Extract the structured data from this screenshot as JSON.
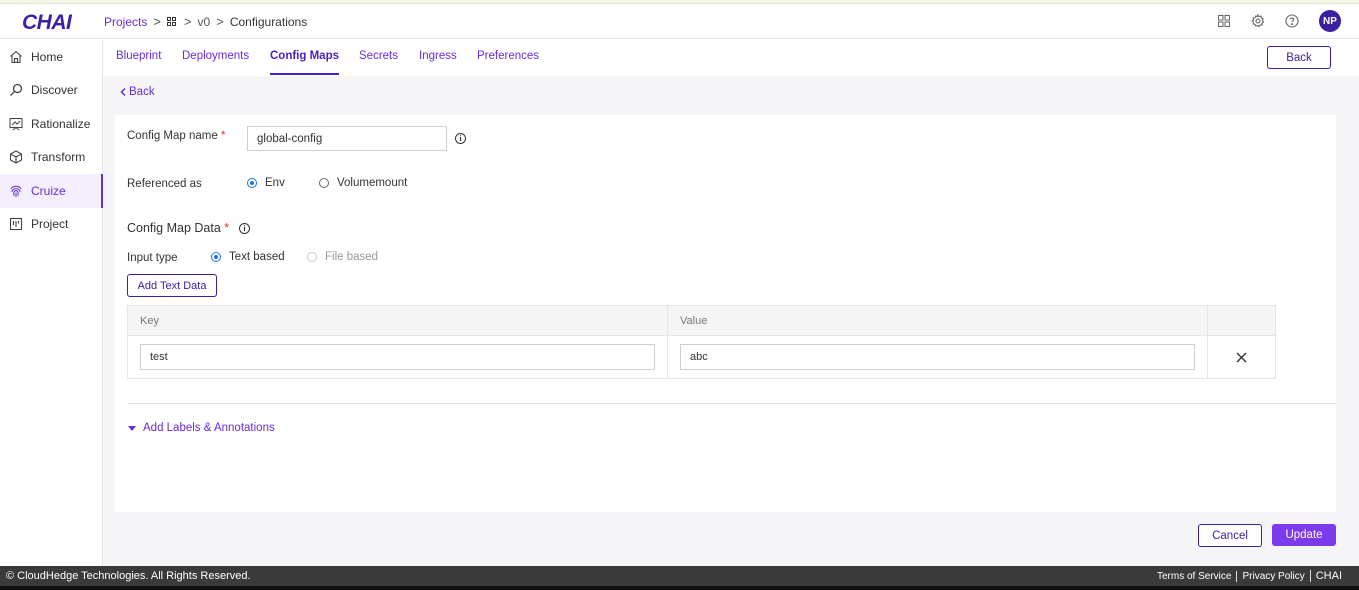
{
  "app": {
    "logo_text": "CHAI"
  },
  "breadcrumb": {
    "projects": "Projects",
    "sep1": ">",
    "sep2": ">",
    "version": "v0",
    "sep3": ">",
    "current": "Configurations"
  },
  "header": {
    "avatar_initials": "NP",
    "icons": [
      "apps-grid-icon",
      "gear-icon",
      "help-icon"
    ]
  },
  "sidebar": {
    "items": [
      {
        "label": "Home",
        "icon": "home-icon"
      },
      {
        "label": "Discover",
        "icon": "discover-icon"
      },
      {
        "label": "Rationalize",
        "icon": "rationalize-icon"
      },
      {
        "label": "Transform",
        "icon": "cube-icon"
      },
      {
        "label": "Cruize",
        "icon": "fingerprint-icon",
        "active": true
      },
      {
        "label": "Project",
        "icon": "project-icon"
      }
    ]
  },
  "tabs": {
    "items": [
      {
        "label": "Blueprint"
      },
      {
        "label": "Deployments"
      },
      {
        "label": "Config Maps",
        "active": true
      },
      {
        "label": "Secrets"
      },
      {
        "label": "Ingress"
      },
      {
        "label": "Preferences"
      }
    ],
    "back_button": "Back"
  },
  "form": {
    "back_link": "Back",
    "name_label": "Config Map name",
    "required_mark": "*",
    "name_value": "global-config",
    "referenced_label": "Referenced as",
    "ref_options": [
      {
        "label": "Env",
        "checked": true
      },
      {
        "label": "Volumemount",
        "checked": false
      }
    ],
    "data_section_title": "Config Map Data",
    "input_type_label": "Input type",
    "input_type_options": [
      {
        "label": "Text based",
        "checked": true
      },
      {
        "label": "File based",
        "checked": false,
        "disabled": true
      }
    ],
    "add_text_button": "Add Text Data",
    "table": {
      "headers": {
        "key": "Key",
        "value": "Value"
      },
      "rows": [
        {
          "key": "test",
          "value": "abc"
        }
      ]
    },
    "labels_link": "Add Labels & Annotations"
  },
  "actions": {
    "cancel": "Cancel",
    "update": "Update"
  },
  "footer": {
    "copyright": "© CloudHedge Technologies. All Rights Reserved.",
    "terms": "Terms of Service",
    "privacy": "Privacy Policy",
    "brand": "CHAI"
  },
  "colors": {
    "accent": "#6a2bd9",
    "primary_dark": "#3a1fa0",
    "update_button": "#7c3aed",
    "footer_bg": "#3a3a3a",
    "logo_accent": "#e6197a"
  }
}
